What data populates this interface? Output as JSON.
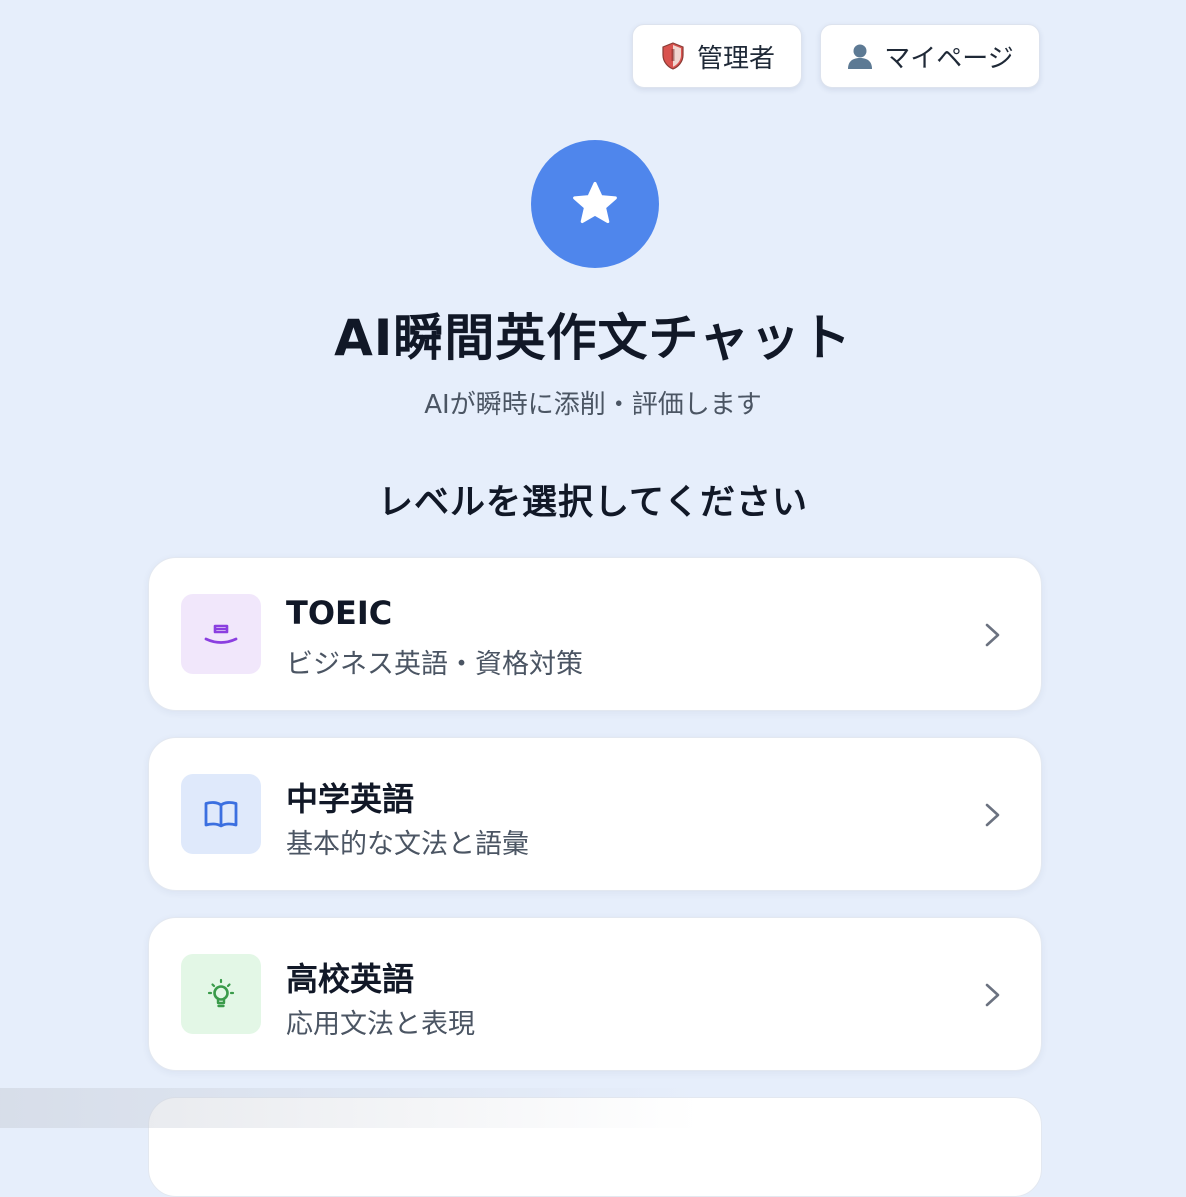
{
  "header": {
    "admin_button": {
      "label": "管理者",
      "icon": "shield-icon"
    },
    "mypage_button": {
      "label": "マイページ",
      "icon": "person-icon"
    }
  },
  "hero": {
    "logo_icon": "star-icon",
    "title": "AI瞬間英作文チャット",
    "subtitle": "AIが瞬時に添削・評価します"
  },
  "level_section": {
    "heading": "レベルを選択してください",
    "levels": [
      {
        "title": "TOEIC",
        "description": "ビジネス英語・資格対策",
        "icon": "briefcase-icon",
        "icon_bg": "#f1e7fb",
        "icon_color": "#8b3fe0"
      },
      {
        "title": "中学英語",
        "description": "基本的な文法と語彙",
        "icon": "book-icon",
        "icon_bg": "#dfe9fb",
        "icon_color": "#3b6fe0"
      },
      {
        "title": "高校英語",
        "description": "応用文法と表現",
        "icon": "lightbulb-icon",
        "icon_bg": "#e3f7e6",
        "icon_color": "#3a9b4a"
      }
    ]
  },
  "colors": {
    "background": "#e6eefb",
    "accent": "#4f86ec"
  }
}
